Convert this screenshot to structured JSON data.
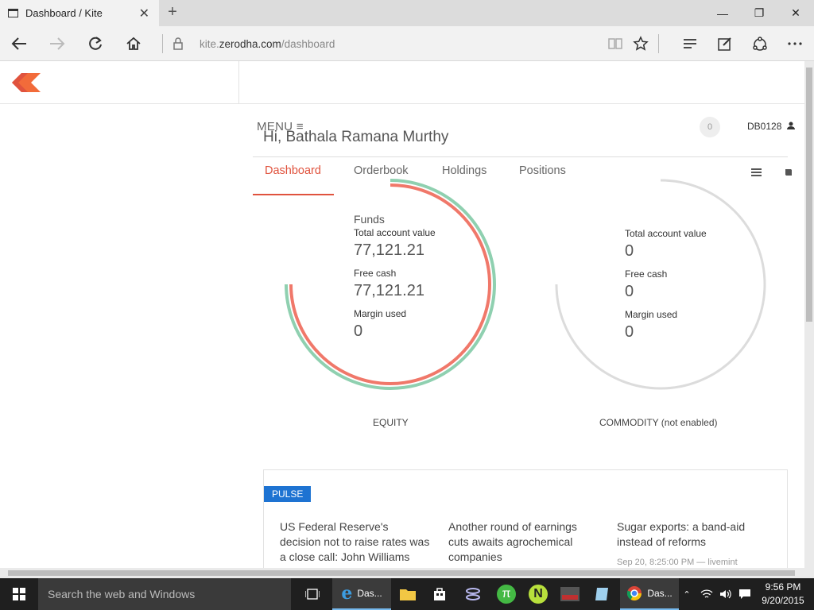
{
  "browser": {
    "tab_title": "Dashboard / Kite",
    "url_prefix": "kite.",
    "url_domain": "zerodha.com",
    "url_path": "/dashboard"
  },
  "header": {
    "menu_label": "MENU",
    "greeting": "Hi, Bathala Ramana Murthy",
    "notification_count": "0",
    "user_id": "DB0128"
  },
  "tabs": [
    "Dashboard",
    "Orderbook",
    "Holdings",
    "Positions"
  ],
  "equity": {
    "title": "Funds",
    "total_label": "Total account value",
    "total_value": "77,121.21",
    "free_cash_label": "Free cash",
    "free_cash_value": "77,121.21",
    "margin_label": "Margin used",
    "margin_value": "0",
    "segment_label": "EQUITY",
    "colors": {
      "outer": "#8fd0b0",
      "inner": "#f0786a"
    }
  },
  "commodity": {
    "total_label": "Total account value",
    "total_value": "0",
    "free_cash_label": "Free cash",
    "free_cash_value": "0",
    "margin_label": "Margin used",
    "margin_value": "0",
    "segment_label": "COMMODITY (not enabled)",
    "colors": {
      "ring": "#dcdcdc"
    }
  },
  "pulse": {
    "badge": "PULSE",
    "news": [
      {
        "headline": "US Federal Reserve's decision not to raise rates was a close call: John Williams"
      },
      {
        "headline": "Another round of earnings cuts awaits agrochemical companies"
      },
      {
        "headline": "Sugar exports: a band-aid instead of reforms",
        "meta": "Sep 20, 8:25:00 PM — livemint"
      }
    ]
  },
  "taskbar": {
    "search_placeholder": "Search the web and Windows",
    "edge_label": "Das...",
    "chrome_label": "Das...",
    "time": "9:56 PM",
    "date": "9/20/2015"
  },
  "accent": {
    "brand": "#e0533e",
    "pulse": "#1e73d2"
  }
}
